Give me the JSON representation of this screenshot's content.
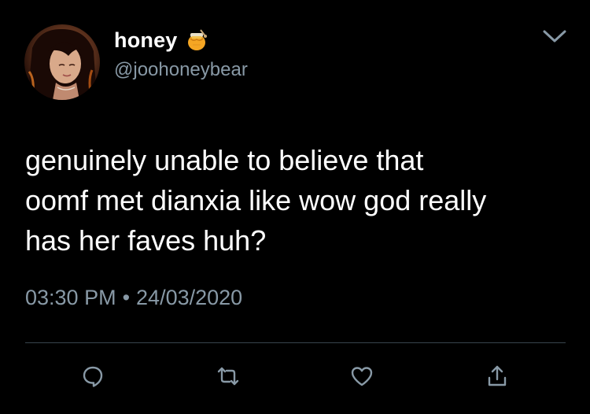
{
  "user": {
    "display_name": "honey",
    "handle": "@joohoneybear",
    "emoji_icon": "honey-pot-icon"
  },
  "tweet": {
    "text": "genuinely unable to believe that\noomf met dianxia like wow god really\nhas her faves huh?",
    "time": "03:30 PM",
    "separator": "•",
    "date": "24/03/2020"
  },
  "actions": [
    "reply-icon",
    "retweet-icon",
    "like-icon",
    "share-icon"
  ],
  "colors": {
    "background": "#000000",
    "text": "#ffffff",
    "secondary_text": "#8899a6",
    "divider": "#38444d"
  }
}
